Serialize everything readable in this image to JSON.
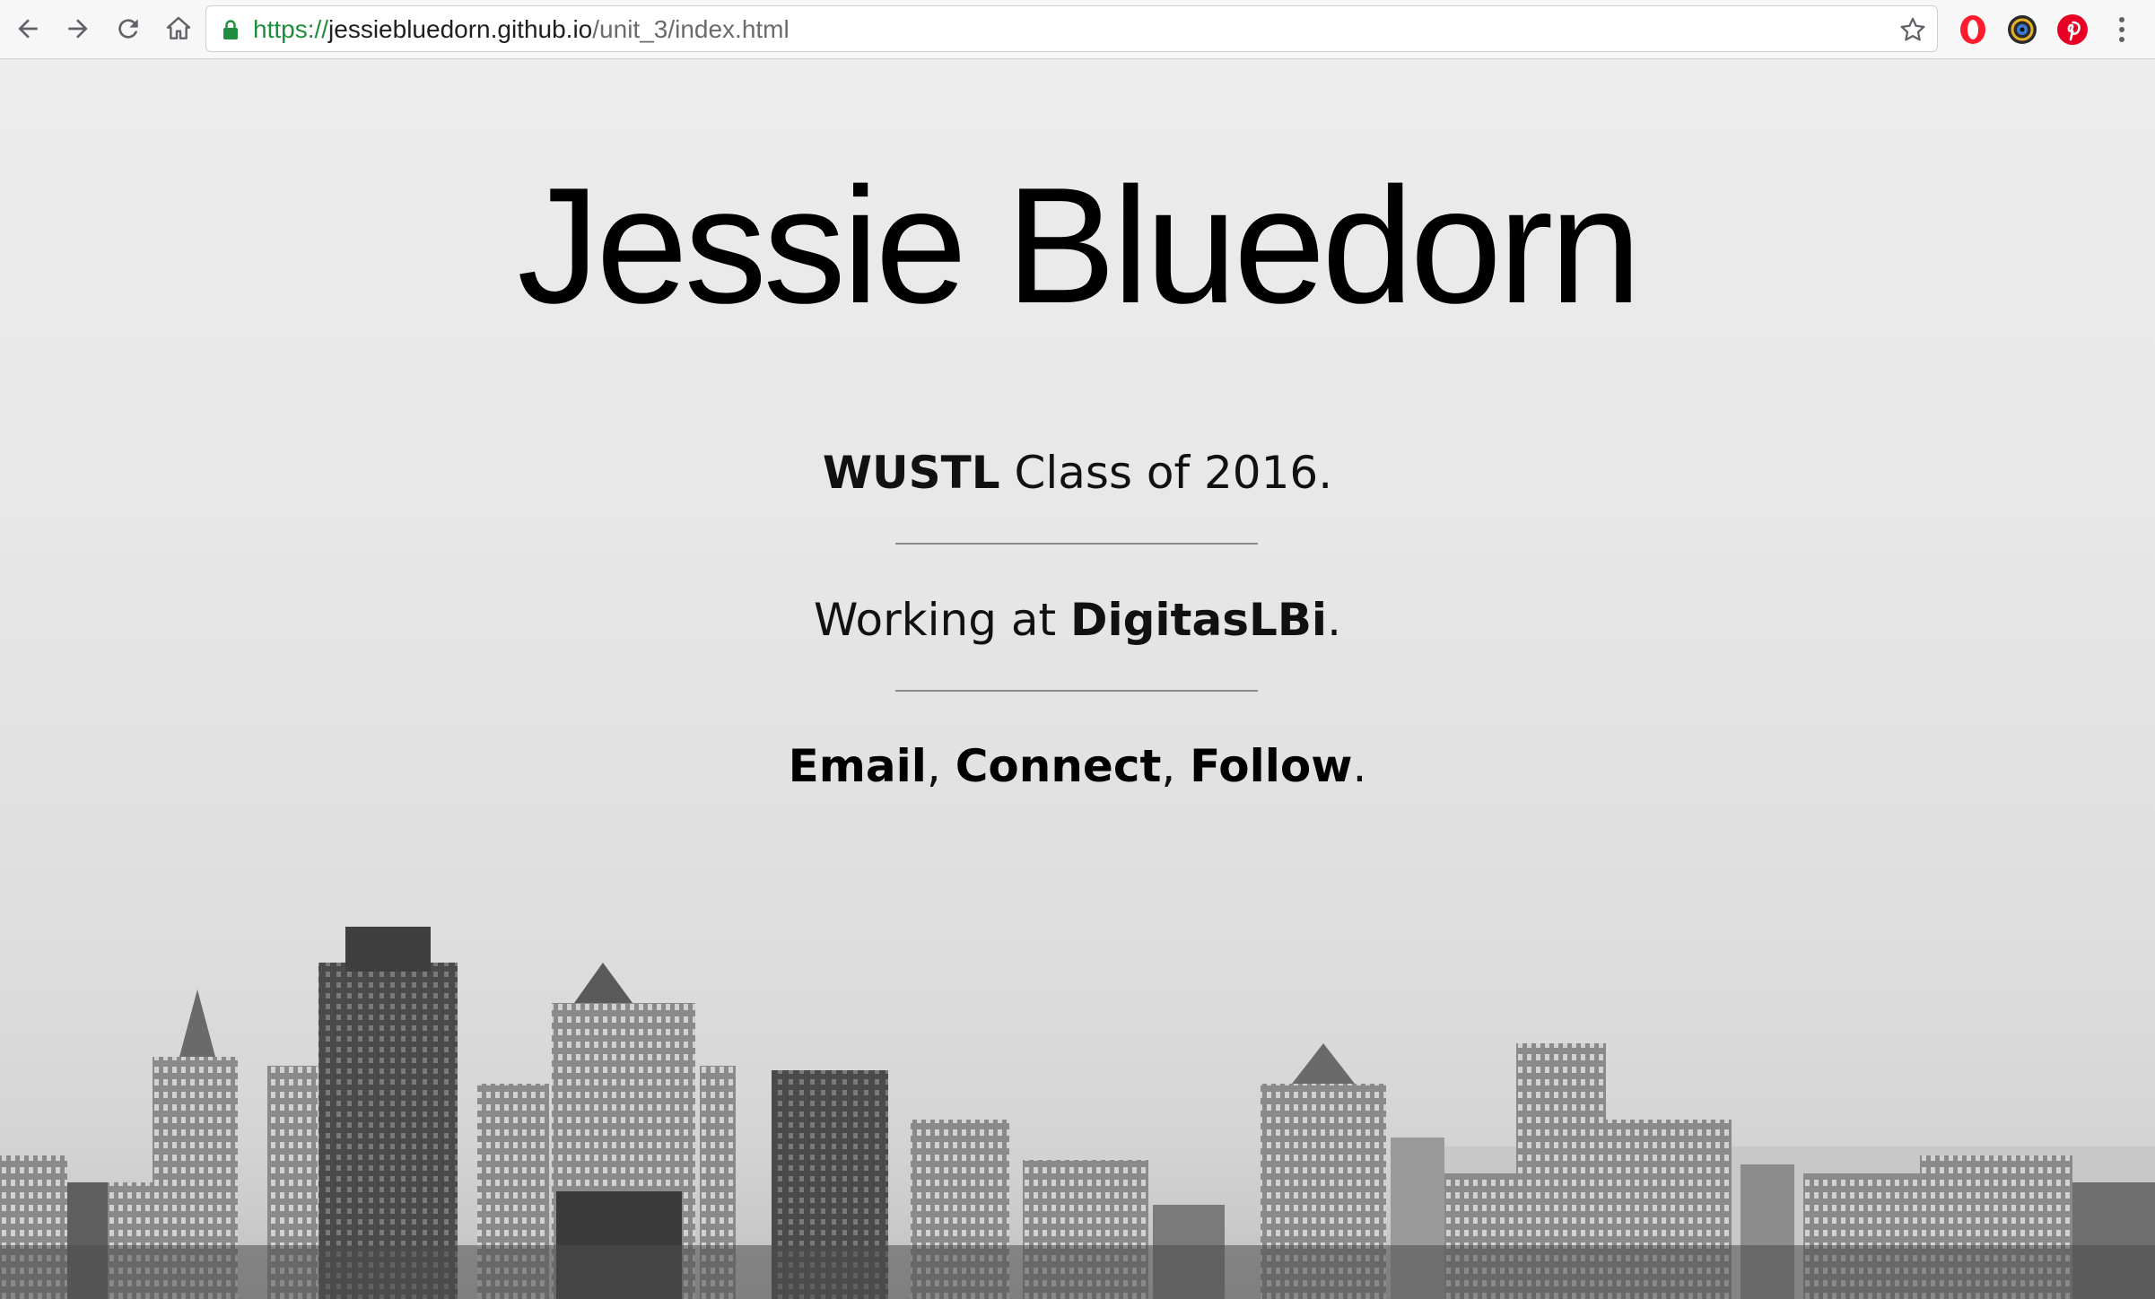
{
  "browser": {
    "url_scheme": "https://",
    "url_host": "jessiebluedorn.github.io",
    "url_path": "/unit_3/index.html",
    "toolbar_icons": [
      "back-icon",
      "forward-icon",
      "reload-icon",
      "home-icon",
      "lock-icon",
      "bookmark-star-icon",
      "opera-extension-icon",
      "camera-extension-icon",
      "pinterest-extension-icon",
      "menu-icon"
    ]
  },
  "page": {
    "title": "Jessie Bluedorn",
    "line1": {
      "bold": "WUSTL",
      "rest": " Class of 2016."
    },
    "line2": {
      "prefix": "Working at ",
      "bold": "DigitasLBi",
      "suffix": "."
    },
    "line3": {
      "link1": "Email",
      "sep1": ", ",
      "link2": "Connect",
      "sep2": ", ",
      "link3": "Follow",
      "end": "."
    }
  },
  "colors": {
    "secure_green": "#1e8e3e",
    "pinterest_red": "#e60023",
    "opera_red": "#ff1b2d"
  }
}
